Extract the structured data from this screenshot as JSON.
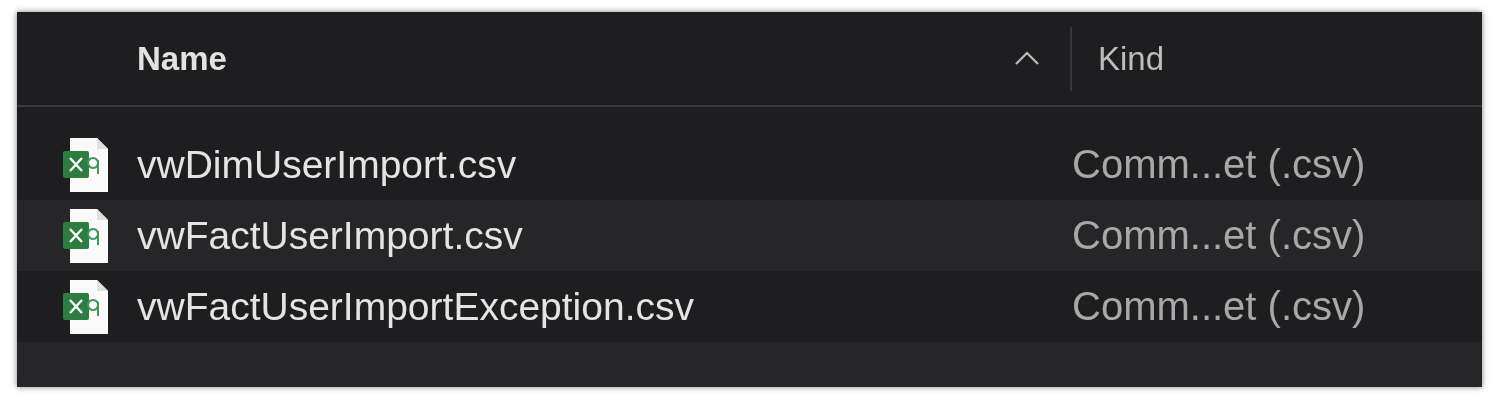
{
  "table": {
    "columns": [
      {
        "label": "Name",
        "sorted": true,
        "sort_ascending": true
      },
      {
        "label": "Kind",
        "sorted": false
      }
    ],
    "rows": [
      {
        "name": "vwDimUserImport.csv",
        "kind": "Comm...et (.csv)"
      },
      {
        "name": "vwFactUserImport.csv",
        "kind": "Comm...et (.csv)"
      },
      {
        "name": "vwFactUserImportException.csv",
        "kind": "Comm...et (.csv)"
      }
    ]
  }
}
